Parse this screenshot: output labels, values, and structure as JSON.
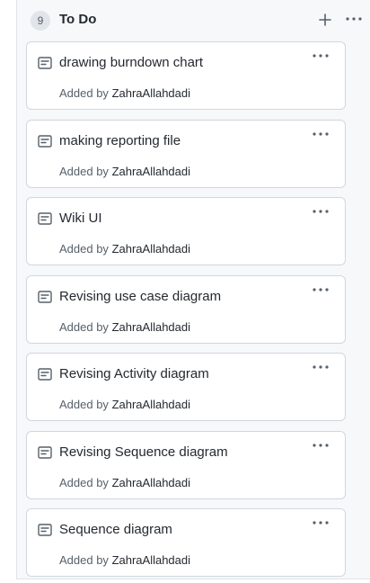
{
  "column": {
    "count": "9",
    "title": "To Do",
    "add_icon": "plus-icon",
    "more_icon": "kebab-horizontal-icon"
  },
  "cards": [
    {
      "title": "drawing burndown chart",
      "added_by": "Added by",
      "author": "ZahraAllahdadi"
    },
    {
      "title": "making reporting file",
      "added_by": "Added by",
      "author": "ZahraAllahdadi"
    },
    {
      "title": "Wiki UI",
      "added_by": "Added by",
      "author": "ZahraAllahdadi"
    },
    {
      "title": "Revising use case diagram",
      "added_by": "Added by",
      "author": "ZahraAllahdadi"
    },
    {
      "title": "Revising Activity diagram",
      "added_by": "Added by",
      "author": "ZahraAllahdadi"
    },
    {
      "title": "Revising Sequence diagram",
      "added_by": "Added by",
      "author": "ZahraAllahdadi"
    },
    {
      "title": "Sequence diagram",
      "added_by": "Added by",
      "author": "ZahraAllahdadi"
    }
  ],
  "colors": {
    "column_bg": "#f6f8fa",
    "card_border": "#d0d7de",
    "text": "#24292f",
    "muted": "#57606a"
  }
}
